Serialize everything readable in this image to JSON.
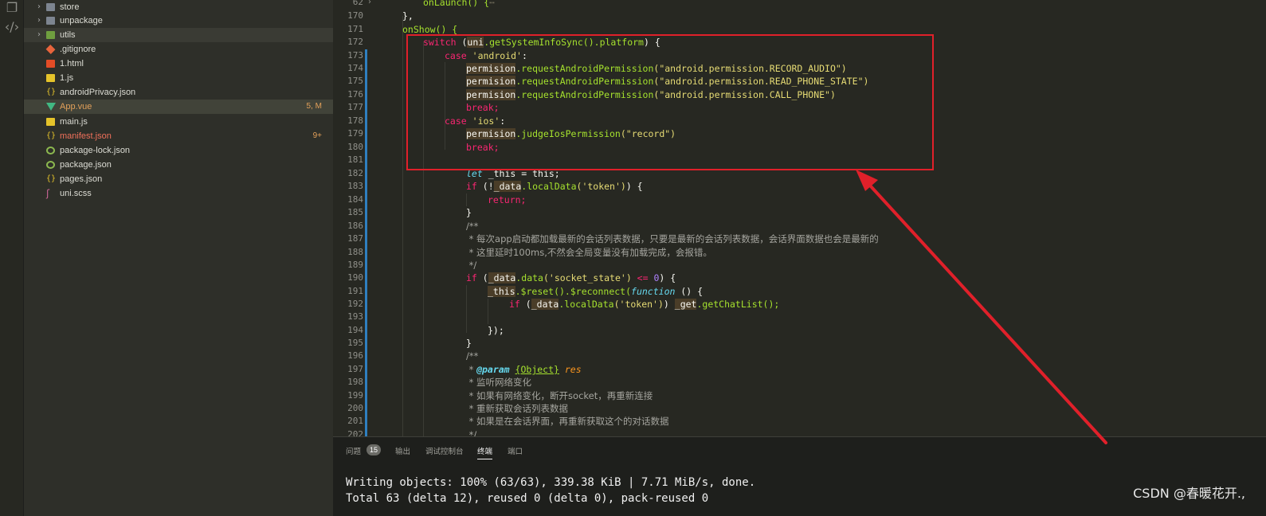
{
  "activity": {
    "icons": [
      "copy-icon",
      "source-control-icon"
    ]
  },
  "explorer": {
    "items": [
      {
        "name": "store",
        "type": "folder",
        "chevron": "›",
        "badge": ""
      },
      {
        "name": "unpackage",
        "type": "folder",
        "chevron": "›",
        "badge": ""
      },
      {
        "name": "utils",
        "type": "folder-green",
        "chevron": "›",
        "badge": ""
      },
      {
        "name": ".gitignore",
        "type": "git",
        "chevron": "",
        "badge": ""
      },
      {
        "name": "1.html",
        "type": "html",
        "chevron": "",
        "badge": ""
      },
      {
        "name": "1.js",
        "type": "js",
        "chevron": "",
        "badge": ""
      },
      {
        "name": "androidPrivacy.json",
        "type": "json",
        "chevron": "",
        "badge": ""
      },
      {
        "name": "App.vue",
        "type": "vue",
        "chevron": "",
        "badge": "5, M"
      },
      {
        "name": "main.js",
        "type": "js",
        "chevron": "",
        "badge": ""
      },
      {
        "name": "manifest.json",
        "type": "json",
        "chevron": "",
        "badge": "9+"
      },
      {
        "name": "package-lock.json",
        "type": "pkg",
        "chevron": "",
        "badge": ""
      },
      {
        "name": "package.json",
        "type": "pkg",
        "chevron": "",
        "badge": ""
      },
      {
        "name": "pages.json",
        "type": "json",
        "chevron": "",
        "badge": ""
      },
      {
        "name": "uni.scss",
        "type": "scss",
        "chevron": "",
        "badge": ""
      }
    ]
  },
  "editor": {
    "line_numbers": [
      "62",
      "170",
      "171",
      "172",
      "173",
      "174",
      "175",
      "176",
      "177",
      "178",
      "179",
      "180",
      "181",
      "182",
      "183",
      "184",
      "185",
      "186",
      "187",
      "188",
      "189",
      "190",
      "191",
      "192",
      "193",
      "194",
      "195",
      "196",
      "197",
      "198",
      "199",
      "200",
      "201",
      "202"
    ],
    "lines": {
      "l62": "onLaunch() {",
      "l62_fold": "⋯",
      "l170": "},",
      "l171": "onShow() {",
      "l172_switch": "switch",
      "l172_rest": " (",
      "l172_uni": "uni",
      "l172_call": ".getSystemInfoSync().platform",
      "l172_end": ") {",
      "l173_case": "case",
      "l173_str": "'android'",
      "l173_colon": ":",
      "l174_obj": "permision",
      "l174_fn": ".requestAndroidPermission",
      "l174_str": "(\"android.permission.RECORD_AUDIO\")",
      "l175_obj": "permision",
      "l175_fn": ".requestAndroidPermission",
      "l175_str": "(\"android.permission.READ_PHONE_STATE\")",
      "l176_obj": "permision",
      "l176_fn": ".requestAndroidPermission",
      "l176_str": "(\"android.permission.CALL_PHONE\")",
      "l177": "break;",
      "l178_case": "case",
      "l178_str": "'ios'",
      "l178_colon": ":",
      "l179_obj": "permision",
      "l179_fn": ".judgeIosPermission",
      "l179_str": "(\"record\")",
      "l180": "break;",
      "l182_let": "let",
      "l182_rest": " _this = this;",
      "l183_if": "if",
      "l183_a": " (!",
      "l183_obj": "_data",
      "l183_fn": ".localData",
      "l183_str": "('token')",
      "l183_end": ") {",
      "l184": "return;",
      "l185": "}",
      "l186": "/**",
      "l187": " * 每次app启动都加载最新的会话列表数据，只要是最新的会话列表数据，会话界面数据也会是最新的",
      "l188": " * 这里延时100ms,不然会全局变量没有加载完成，会报错。",
      "l189": " */",
      "l190_if": "if",
      "l190_a": " (",
      "l190_obj": "_data",
      "l190_fn": ".data",
      "l190_str": "('socket_state')",
      "l190_op": " <= ",
      "l190_num": "0",
      "l190_end": ") {",
      "l191_obj": "_this",
      "l191_a": ".$reset().$reconnect(",
      "l191_fn": "function",
      "l191_end": " () {",
      "l192_if": "if",
      "l192_a": " (",
      "l192_obj": "_data",
      "l192_fn": ".localData",
      "l192_str": "('token')",
      "l192_end": ") ",
      "l192_get": "_get",
      "l192_call": ".getChatList();",
      "l194": "});",
      "l195": "}",
      "l196": "/**",
      "l197_star": " * ",
      "l197_tag": "@param",
      "l197_type": "{Object}",
      "l197_name": " res",
      "l198": " * 监听网络变化",
      "l199": " * 如果有网络变化，断开socket，再重新连接",
      "l200": " * 重新获取会话列表数据",
      "l201": " * 如果是在会话界面，再重新获取这个的对话数据",
      "l202": " */"
    }
  },
  "panel": {
    "tabs": [
      "问题",
      "输出",
      "调试控制台",
      "终端",
      "端口"
    ],
    "problems_count": "15",
    "terminal": [
      "Writing objects: 100% (63/63), 339.38 KiB | 7.71 MiB/s, done.",
      "Total 63 (delta 12), reused 0 (delta 0), pack-reused 0"
    ]
  },
  "watermark": "CSDN @春暖花开.,",
  "colors": {
    "annotation": "#e0202a",
    "background": "#272822",
    "sidebar": "#2e2f29"
  }
}
